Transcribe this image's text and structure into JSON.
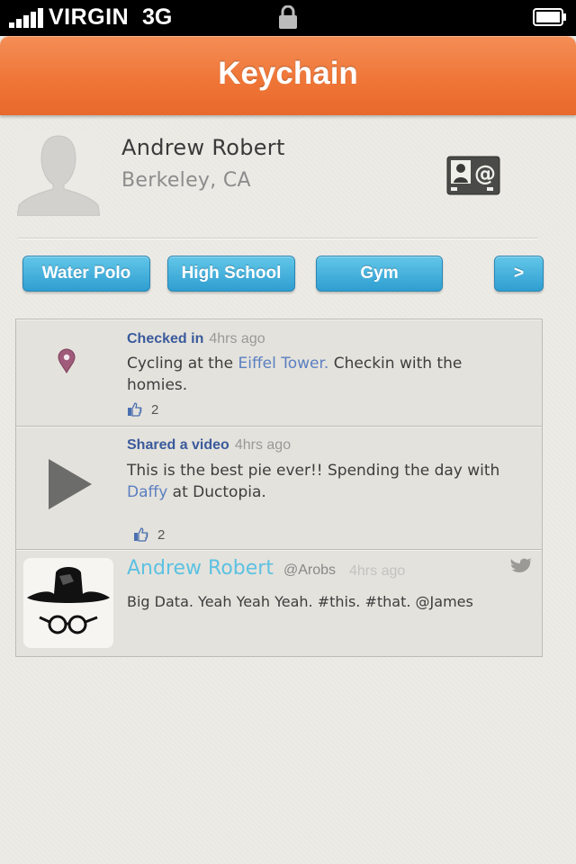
{
  "status_bar": {
    "carrier": "VIRGIN",
    "network": "3G",
    "signal_bars": 5,
    "battery": "full"
  },
  "nav": {
    "title": "Keychain"
  },
  "profile": {
    "name": "Andrew Robert",
    "location": "Berkeley, CA",
    "avatar_icon": "person-silhouette-icon",
    "contact_icon": "contact-card-icon"
  },
  "tags": {
    "items": [
      "Water Polo",
      "High School",
      "Gym"
    ],
    "more_label": ">"
  },
  "feed": [
    {
      "type": "checkin",
      "icon": "map-pin-icon",
      "action": "Checked in",
      "time": "4hrs ago",
      "text_before": "Cycling at the ",
      "link": "Eiffel Tower.",
      "text_after": " Checkin with the homies.",
      "likes": "2"
    },
    {
      "type": "video",
      "icon": "play-icon",
      "action": "Shared a video",
      "time": "4hrs ago",
      "text_before": "This is the best pie ever!! Spending the day with ",
      "link": "Daffy",
      "text_after": " at Ductopia.",
      "likes": "2"
    },
    {
      "type": "tweet",
      "icon": "twitter-bird-icon",
      "author": "Andrew Robert",
      "handle": "@Arobs",
      "time": "4hrs ago",
      "text": "Big Data. Yeah Yeah Yeah. #this. #that. @James"
    }
  ],
  "colors": {
    "nav_orange": "#ef7637",
    "tag_blue": "#2f9ed1",
    "action_blue": "#3a5a9c",
    "link_blue": "#5a7fc1",
    "tweet_name": "#5cc1e2",
    "pin": "#a05a7a"
  }
}
